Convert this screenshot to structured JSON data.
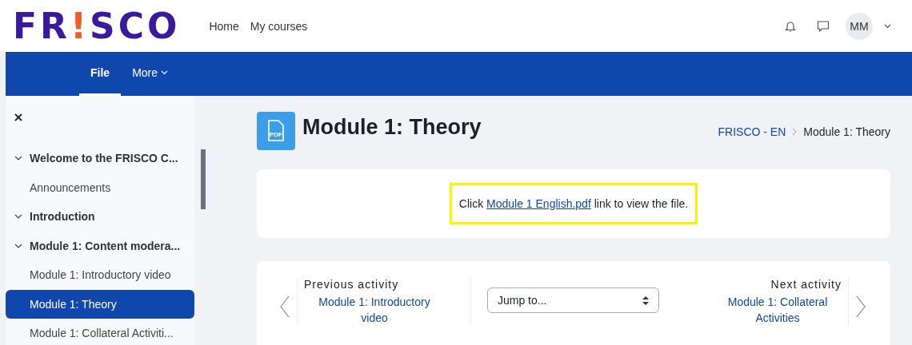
{
  "logo": {
    "parts": [
      {
        "text": "FR",
        "accent": false
      },
      {
        "text": "!",
        "accent": true
      },
      {
        "text": "SCO",
        "accent": false
      }
    ]
  },
  "top_nav": [
    {
      "label": "Home"
    },
    {
      "label": "My courses"
    }
  ],
  "user": {
    "initials": "MM"
  },
  "secondary_nav": [
    {
      "label": "File",
      "selected": true,
      "dropdown": false
    },
    {
      "label": "More",
      "selected": false,
      "dropdown": true
    }
  ],
  "sidebar": {
    "items": [
      {
        "label": "Welcome to the FRISCO C...",
        "kind": "section",
        "expanded": true,
        "selected": false
      },
      {
        "label": "Announcements",
        "kind": "activity",
        "selected": false
      },
      {
        "label": "Introduction",
        "kind": "section",
        "expanded": true,
        "selected": false
      },
      {
        "label": "Module 1: Content modera...",
        "kind": "section",
        "expanded": true,
        "selected": false
      },
      {
        "label": "Module 1: Introductory video",
        "kind": "activity",
        "selected": false
      },
      {
        "label": "Module 1: Theory",
        "kind": "activity",
        "selected": true
      },
      {
        "label": "Module 1: Collateral Activiti...",
        "kind": "activity",
        "selected": false
      }
    ]
  },
  "page": {
    "title": "Module 1: Theory",
    "icon_label": "PDF",
    "breadcrumb": [
      {
        "label": "FRISCO - EN",
        "link": true
      },
      {
        "label": "Module 1: Theory",
        "link": false
      }
    ],
    "content": {
      "before": "Click",
      "link": "Module 1 English.pdf",
      "after": "link to view the file."
    }
  },
  "activity_nav": {
    "previous_label": "Previous activity",
    "previous_link": "Module 1: Introductory video",
    "jump_placeholder": "Jump to...",
    "next_label": "Next activity",
    "next_link": "Module 1: Collateral Activities"
  }
}
